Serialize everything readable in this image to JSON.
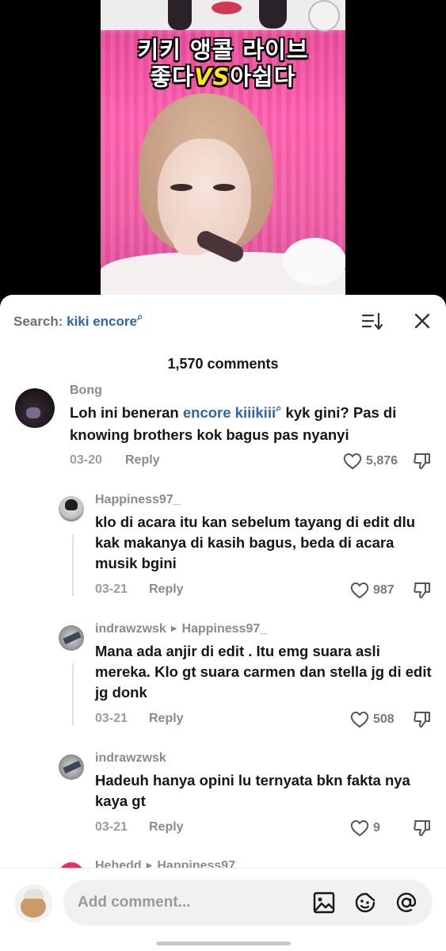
{
  "video": {
    "caption_line1": "키키 앵콜 라이브",
    "caption_line2_left": "좋다",
    "caption_line2_vs": "VS",
    "caption_line2_right": "아쉽다"
  },
  "header": {
    "search_label": "Search:",
    "search_query": "kiki encore",
    "comment_count": "1,570 comments"
  },
  "comments": [
    {
      "username": "Bong",
      "text_before": "Loh ini beneran ",
      "text_link": "encore kiiikiii",
      "text_after": " kyk gini? Pas di knowing brothers kok bagus pas nyanyi",
      "date": "03-20",
      "reply_label": "Reply",
      "likes": "5,876"
    },
    {
      "username": "Happiness97_",
      "text": "klo di acara itu kan sebelum tayang di edit dlu kak makanya di kasih bagus, beda di acara musik bgini",
      "date": "03-21",
      "reply_label": "Reply",
      "likes": "987"
    },
    {
      "username": "indrawzwsk",
      "reply_to": "Happiness97_",
      "text": "Mana ada anjir di edit . Itu emg suara asli mereka. Klo gt suara carmen dan stella jg di edit jg donk",
      "date": "03-21",
      "reply_label": "Reply",
      "likes": "508"
    },
    {
      "username": "indrawzwsk",
      "text": "Hadeuh hanya opini lu ternyata bkn fakta nya kaya gt",
      "date": "03-21",
      "reply_label": "Reply",
      "likes": "9"
    },
    {
      "username": "Hehedd",
      "reply_to": "Happiness97"
    }
  ],
  "input": {
    "placeholder": "Add comment..."
  },
  "colors": {
    "link_blue": "#2f65a5",
    "muted_gray": "#8b8b8b",
    "text_dark": "#161616"
  }
}
